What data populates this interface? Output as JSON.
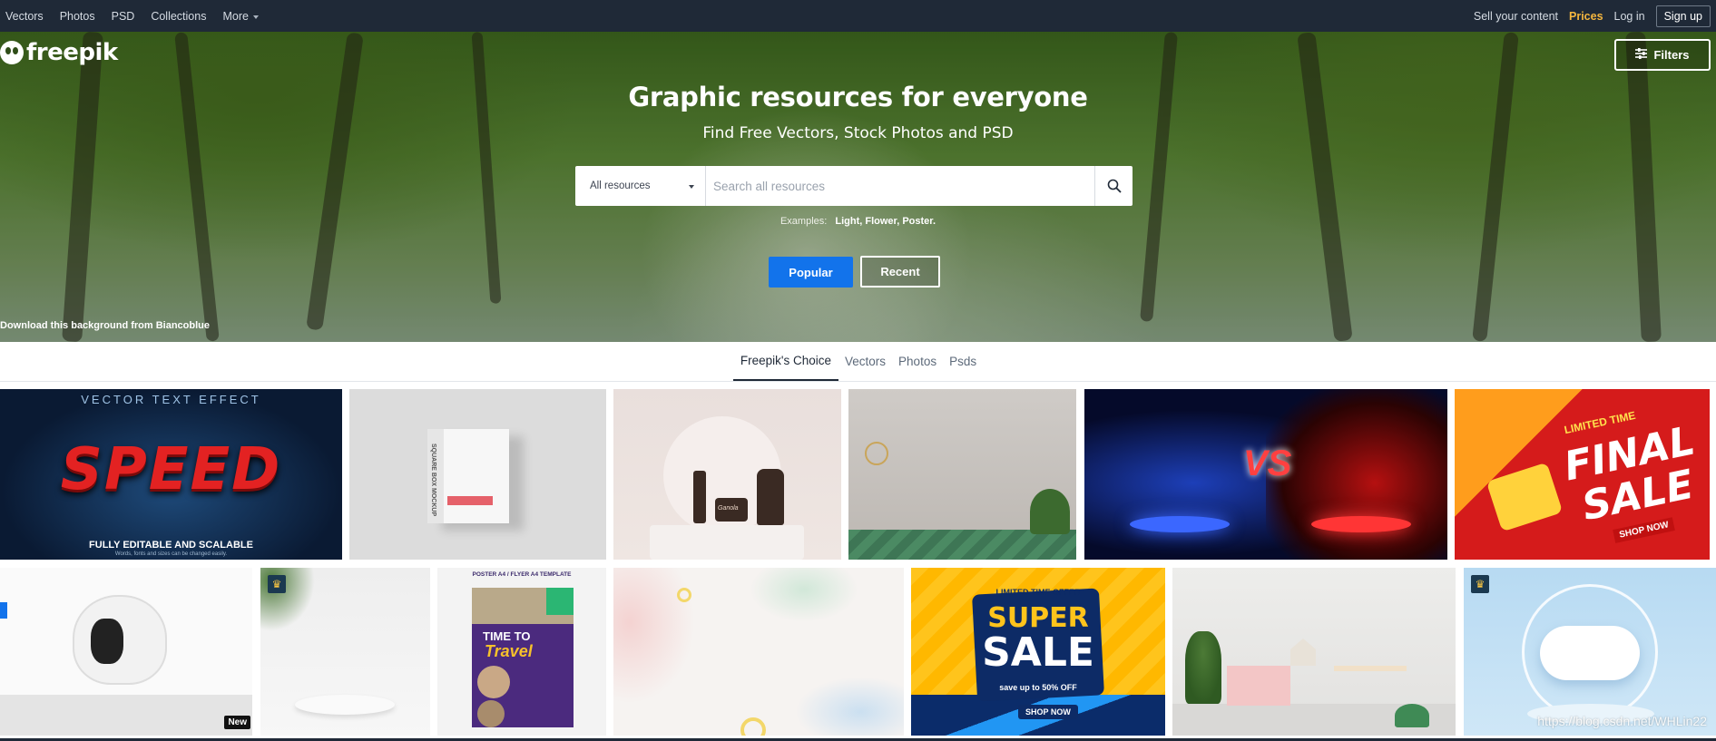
{
  "topnav": {
    "left": [
      "Vectors",
      "Photos",
      "PSD",
      "Collections"
    ],
    "more": "More",
    "sell": "Sell your content",
    "prices": "Prices",
    "login": "Log in",
    "signup": "Sign up"
  },
  "brand": {
    "logo_text": "freepik"
  },
  "filters_label": "Filters",
  "hero": {
    "title": "Graphic resources for everyone",
    "subtitle": "Find Free Vectors, Stock Photos and PSD",
    "select_value": "All resources",
    "search_placeholder": "Search all resources",
    "examples_label": "Examples:",
    "examples_tags": "Light, Flower, Poster.",
    "popular": "Popular",
    "recent": "Recent",
    "credit": "Download this background from Biancoblue"
  },
  "tabs": [
    "Freepik's Choice",
    "Vectors",
    "Photos",
    "Psds"
  ],
  "tiles": {
    "speed_top": "VECTOR TEXT EFFECT",
    "speed_main": "SPEED",
    "speed_bottom": "FULLY EDITABLE AND SCALABLE",
    "speed_small": "Words, fonts and sizes can be changed easily.",
    "box_text": "SQUARE BOX MOCKUP",
    "cosmetic_brand": "Ganola",
    "vs": "VS",
    "sale_limited": "LIMITED TIME",
    "sale_final": "FINAL",
    "sale_sale": "SALE",
    "sale_shop": "SHOP NOW",
    "new_badge": "New",
    "crown_icon": "♛",
    "poster_top": "POSTER A4 / FLYER A4 TEMPLATE",
    "poster_title_1": "TIME TO",
    "poster_title_2": "Travel",
    "super_limited": "LIMITED TIME OFFER",
    "super_1": "SUPER",
    "super_2": "SALE",
    "super_sub": "save up to 50% OFF",
    "super_shop": "SHOP NOW"
  },
  "watermark": "https://blog.csdn.net/WHLin22"
}
